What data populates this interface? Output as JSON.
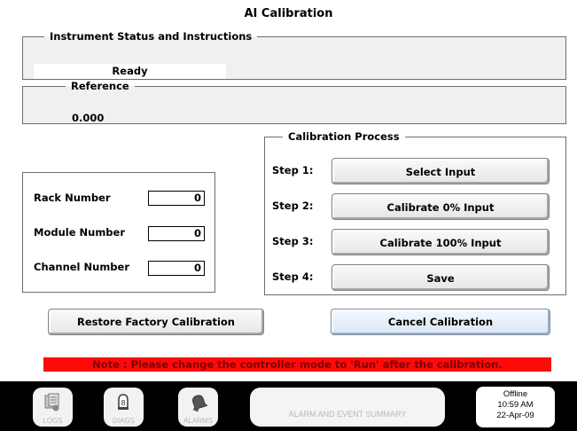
{
  "window": {
    "title": "AI Calibration"
  },
  "status": {
    "legend": "Instrument Status and Instructions",
    "value": "Ready"
  },
  "reference": {
    "legend": "Reference",
    "value": "0.000"
  },
  "rack": {
    "rows": [
      {
        "label": "Rack Number",
        "value": "0"
      },
      {
        "label": "Module Number",
        "value": "0"
      },
      {
        "label": "Channel Number",
        "value": "0"
      }
    ]
  },
  "calibration": {
    "legend": "Calibration Process",
    "steps": [
      {
        "label": "Step 1:",
        "button": "Select Input"
      },
      {
        "label": "Step 2:",
        "button": "Calibrate 0% Input"
      },
      {
        "label": "Step 3:",
        "button": "Calibrate 100% Input"
      },
      {
        "label": "Step 4:",
        "button": "Save"
      }
    ]
  },
  "actions": {
    "restore": "Restore Factory Calibration",
    "cancel": "Cancel Calibration"
  },
  "note": "Note : Please change the controller mode to 'Run' after the calibration.",
  "bottom_bar": {
    "nav": [
      {
        "label": "LOGS",
        "icon": "logs-icon"
      },
      {
        "label": "DIAGS",
        "icon": "diags-icon"
      },
      {
        "label": "ALARMS",
        "icon": "alarms-icon"
      }
    ],
    "summary": "ALARM AND EVENT SUMMARY",
    "status": {
      "mode": "Offline",
      "time": "10:59 AM",
      "date": "22-Apr-09"
    }
  }
}
